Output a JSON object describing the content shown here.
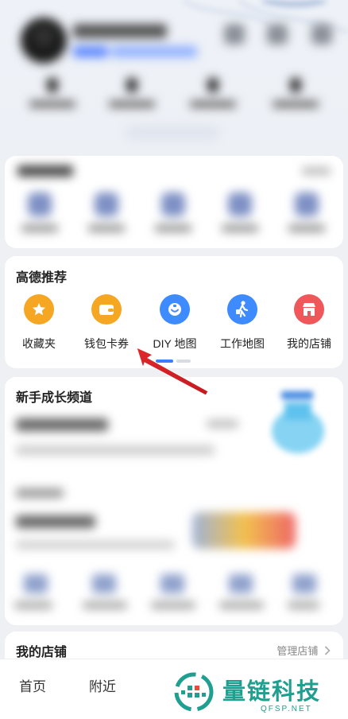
{
  "recommend": {
    "title": "高德推荐",
    "items": [
      {
        "label": "收藏夹",
        "icon": "star-icon",
        "color": "#f5a623"
      },
      {
        "label": "钱包卡券",
        "icon": "wallet-icon",
        "color": "#f5a623"
      },
      {
        "label": "DIY 地图",
        "icon": "diy-map-icon",
        "color": "#3d8bff"
      },
      {
        "label": "工作地图",
        "icon": "walker-icon",
        "color": "#3d8bff"
      },
      {
        "label": "我的店铺",
        "icon": "store-icon",
        "color": "#f0575a"
      }
    ]
  },
  "growth": {
    "title": "新手成长频道"
  },
  "store": {
    "title": "我的店铺",
    "manage": "管理店铺"
  },
  "nav": {
    "home": "首页",
    "nearby": "附近"
  },
  "watermark": {
    "name": "量链科技",
    "url": "QFSP.NET"
  },
  "colors": {
    "accent": "#3d7bff",
    "annotation_arrow": "#e0262b",
    "watermark": "#1f9f8f"
  }
}
